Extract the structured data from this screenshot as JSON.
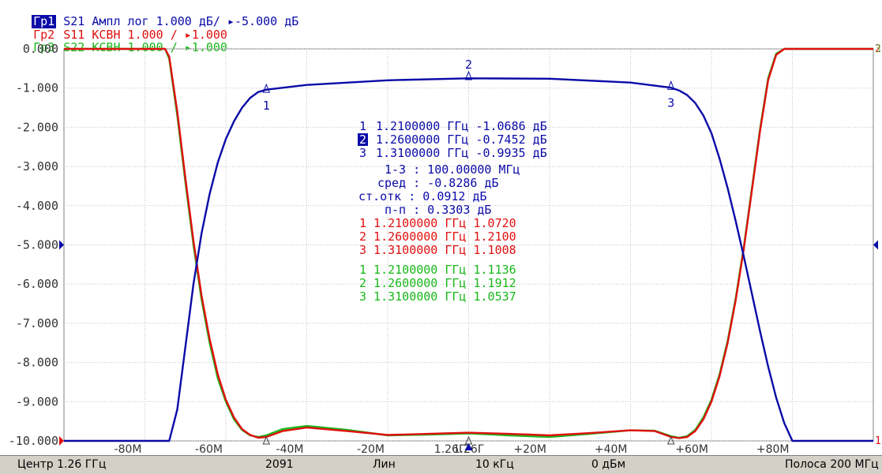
{
  "header": {
    "lines": [
      {
        "tag": "Гр1",
        "text": " S21 Ампл лог 1.000 дБ/ ",
        "ref": "-5.000 дБ",
        "color": "#0a0aa8",
        "selected": true
      },
      {
        "tag": "Гр2",
        "text": " S11 КСВН 1.000 / ",
        "ref": "1.000",
        "color": "#e01010",
        "selected": false
      },
      {
        "tag": "Гр3",
        "text": " S22 КСВН 1.000 / ",
        "ref": "1.000",
        "color": "#18b818",
        "selected": false
      }
    ]
  },
  "chart_data": {
    "type": "line",
    "center_label": "1.26Г",
    "y_ticks": [
      "0.000",
      "-1.000",
      "-2.000",
      "-3.000",
      "-4.000",
      "-5.000",
      "-6.000",
      "-7.000",
      "-8.000",
      "-9.000",
      "-10.000"
    ],
    "x_ticks": [
      "-80М",
      "-60М",
      "-40М",
      "-20М",
      "1.26Г",
      "+20М",
      "+40М",
      "+60М",
      "+80М"
    ],
    "xlim_mhz": [
      -100,
      100
    ],
    "ylim_db": [
      -10,
      0
    ],
    "reference_level_db": -5,
    "right_markers": {
      "top_s11": "2",
      "top_s22": "3",
      "bottom_s11": "1"
    },
    "series": [
      {
        "name": "S21",
        "color": "#0a0aa8",
        "x": [
          -100,
          -78,
          -74,
          -72,
          -70,
          -68,
          -66,
          -64,
          -62,
          -60,
          -58,
          -56,
          -54,
          -52,
          -50,
          -40,
          -20,
          0,
          20,
          40,
          50,
          52,
          54,
          56,
          58,
          60,
          62,
          64,
          66,
          68,
          70,
          72,
          74,
          76,
          78,
          80,
          100
        ],
        "y": [
          -10,
          -10,
          -10,
          -9.2,
          -7.6,
          -6.0,
          -4.7,
          -3.7,
          -2.9,
          -2.3,
          -1.85,
          -1.5,
          -1.25,
          -1.1,
          -1.04,
          -0.92,
          -0.8,
          -0.75,
          -0.76,
          -0.86,
          -0.99,
          -1.06,
          -1.18,
          -1.38,
          -1.7,
          -2.15,
          -2.8,
          -3.55,
          -4.4,
          -5.3,
          -6.25,
          -7.2,
          -8.1,
          -8.9,
          -9.55,
          -10,
          -10
        ]
      },
      {
        "name": "S11",
        "color": "#e01010",
        "x": [
          -100,
          -75,
          -74,
          -72,
          -70,
          -68,
          -66,
          -64,
          -62,
          -60,
          -58,
          -56,
          -54,
          -52,
          -50,
          -46,
          -40,
          -30,
          -20,
          -10,
          0,
          10,
          20,
          30,
          40,
          46,
          50,
          52,
          54,
          56,
          58,
          60,
          62,
          64,
          66,
          68,
          70,
          72,
          74,
          76,
          78,
          100
        ],
        "y": [
          0,
          0,
          -0.2,
          -1.6,
          -3.3,
          -4.9,
          -6.3,
          -7.4,
          -8.3,
          -8.95,
          -9.4,
          -9.7,
          -9.85,
          -9.92,
          -9.9,
          -9.75,
          -9.66,
          -9.75,
          -9.85,
          -9.82,
          -9.79,
          -9.82,
          -9.86,
          -9.8,
          -9.73,
          -9.75,
          -9.9,
          -9.93,
          -9.9,
          -9.75,
          -9.45,
          -9.0,
          -8.35,
          -7.5,
          -6.4,
          -5.1,
          -3.6,
          -2.1,
          -0.8,
          -0.15,
          0,
          0
        ]
      },
      {
        "name": "S22",
        "color": "#18b818",
        "x": [
          -100,
          -75,
          -74,
          -72,
          -70,
          -68,
          -66,
          -64,
          -62,
          -60,
          -58,
          -56,
          -54,
          -52,
          -50,
          -46,
          -40,
          -30,
          -20,
          -10,
          0,
          10,
          20,
          30,
          40,
          46,
          50,
          52,
          54,
          56,
          58,
          60,
          62,
          64,
          66,
          68,
          70,
          72,
          74,
          76,
          78,
          100
        ],
        "y": [
          0,
          0,
          -0.25,
          -1.7,
          -3.4,
          -5.0,
          -6.4,
          -7.5,
          -8.4,
          -9.0,
          -9.45,
          -9.72,
          -9.86,
          -9.9,
          -9.86,
          -9.7,
          -9.62,
          -9.72,
          -9.86,
          -9.84,
          -9.81,
          -9.86,
          -9.9,
          -9.82,
          -9.73,
          -9.74,
          -9.88,
          -9.92,
          -9.88,
          -9.72,
          -9.4,
          -8.95,
          -8.3,
          -7.45,
          -6.35,
          -5.05,
          -3.55,
          -2.05,
          -0.75,
          -0.12,
          0,
          0
        ]
      }
    ],
    "markers": [
      {
        "id": "1",
        "x": -50,
        "y": -1.0686
      },
      {
        "id": "2",
        "x": 0,
        "y": -0.7452
      },
      {
        "id": "3",
        "x": 50,
        "y": -0.9935
      }
    ]
  },
  "readout": {
    "s21": [
      {
        "num": "1",
        "text": "1.2100000 ГГц -1.0686 дБ"
      },
      {
        "num": "2",
        "text": "1.2600000 ГГц -0.7452 дБ",
        "active": true
      },
      {
        "num": "3",
        "text": "1.3100000 ГГц -0.9935 дБ"
      }
    ],
    "stats": [
      "1-3 :  100.00000 МГц",
      " сред : -0.8286 дБ",
      "ст.отк :  0.0912 дБ",
      "   п-п :  0.3303 дБ"
    ],
    "s11": [
      "1 1.2100000 ГГц  1.0720",
      "2 1.2600000 ГГц  1.2100",
      "3 1.3100000 ГГц  1.1008"
    ],
    "s22": [
      "1 1.2100000 ГГц  1.1136",
      "2 1.2600000 ГГц  1.1912",
      "3 1.3100000 ГГц  1.0537"
    ]
  },
  "status": {
    "center": "Центр 1.26 ГГц",
    "points": "2091",
    "sweep": "Лин",
    "ifbw": "10 кГц",
    "power": "0 дБм",
    "span": "Полоса 200 МГц"
  }
}
